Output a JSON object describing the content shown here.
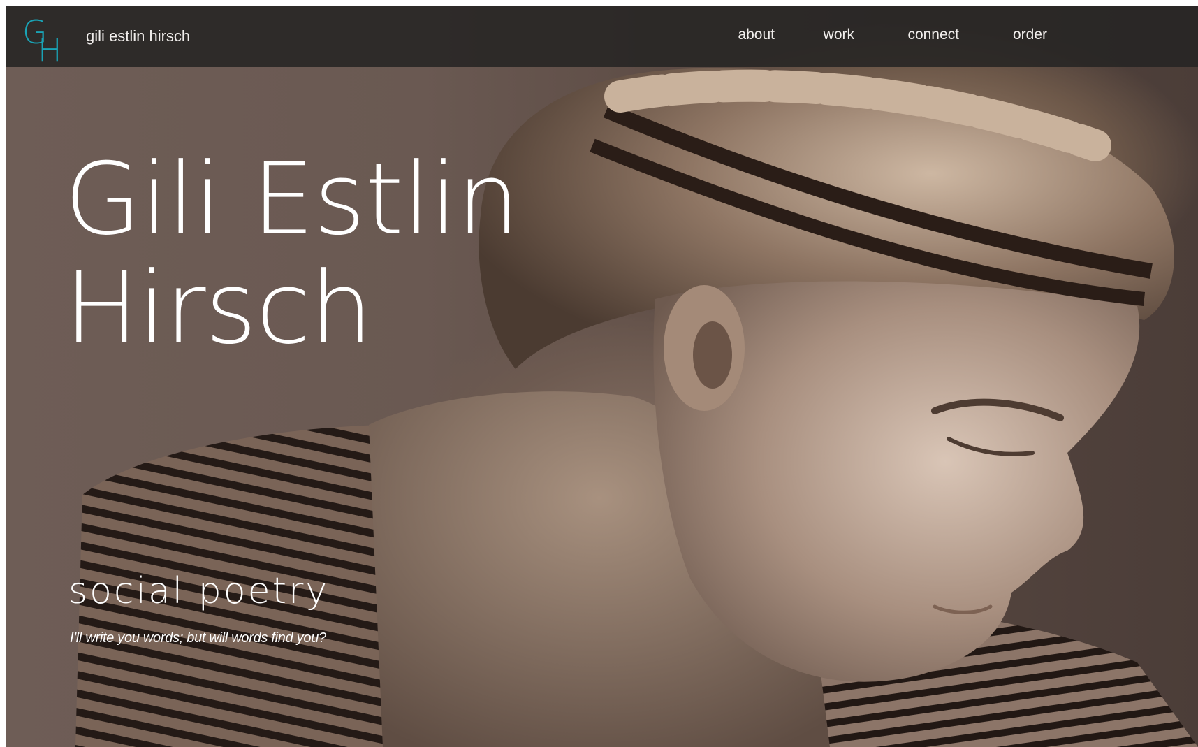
{
  "site": {
    "logo_letters": [
      "G",
      "H"
    ],
    "name": "gili estlin hirsch",
    "accent_color": "#1aa3b5"
  },
  "nav": {
    "items": [
      {
        "label": "about"
      },
      {
        "label": "work"
      },
      {
        "label": "connect"
      },
      {
        "label": "order"
      }
    ]
  },
  "hero": {
    "title_line_1": "Gili Estlin",
    "title_line_2": "Hirsch",
    "tagline": "social poetry",
    "subtagline": "I'll write you words; but will words find you?"
  }
}
